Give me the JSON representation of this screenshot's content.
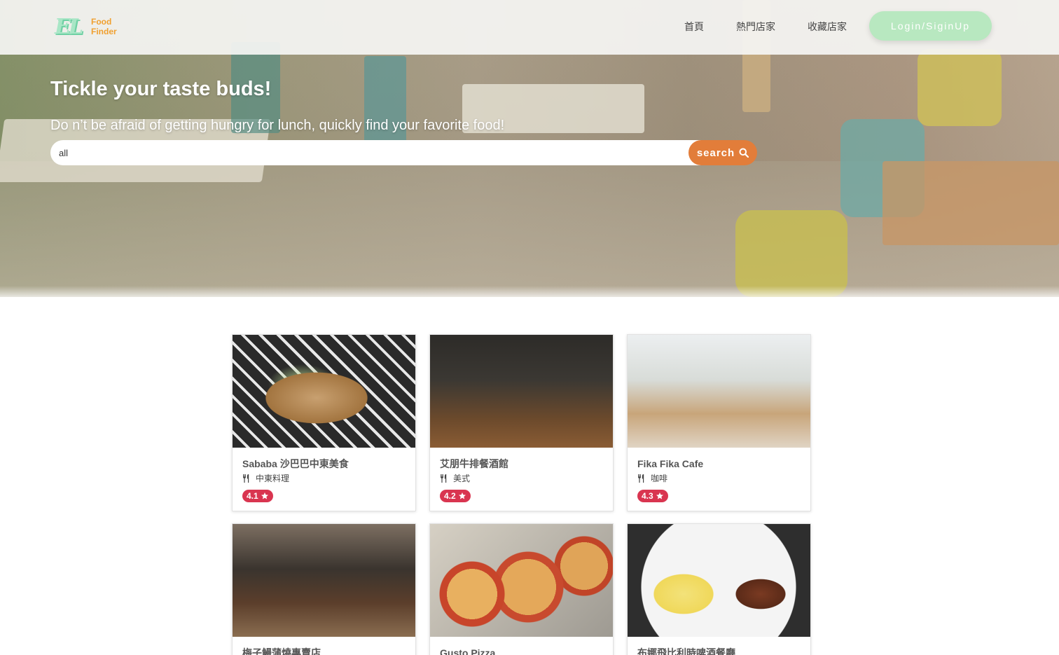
{
  "navbar": {
    "logo_mark": "EL",
    "logo_line1": "Food",
    "logo_line2": "Finder",
    "links": [
      "首頁",
      "熱門店家",
      "收藏店家"
    ],
    "login_label": "Login/SiginUp"
  },
  "hero": {
    "title": "Tickle your taste buds!",
    "subtitle": "Do n’t be afraid of getting hungry for lunch, quickly find your favorite food!",
    "search_value": "all",
    "search_label": "search"
  },
  "restaurants": [
    {
      "name": "Sababa 沙巴巴中東美食",
      "category": "中東料理",
      "rating": "4.1"
    },
    {
      "name": "艾朋牛排餐酒館",
      "category": "美式",
      "rating": "4.2"
    },
    {
      "name": "Fika Fika Cafe",
      "category": "咖啡",
      "rating": "4.3"
    },
    {
      "name": "梅子鰻蒲燒專賣店",
      "category": "",
      "rating": ""
    },
    {
      "name": "Gusto Pizza",
      "category": "",
      "rating": ""
    },
    {
      "name": "布娜飛比利時啤酒餐廳",
      "category": "",
      "rating": ""
    }
  ],
  "colors": {
    "search_button": "#e27d3a",
    "login_button": "#b8e8c0",
    "rating_badge": "#d93550"
  }
}
